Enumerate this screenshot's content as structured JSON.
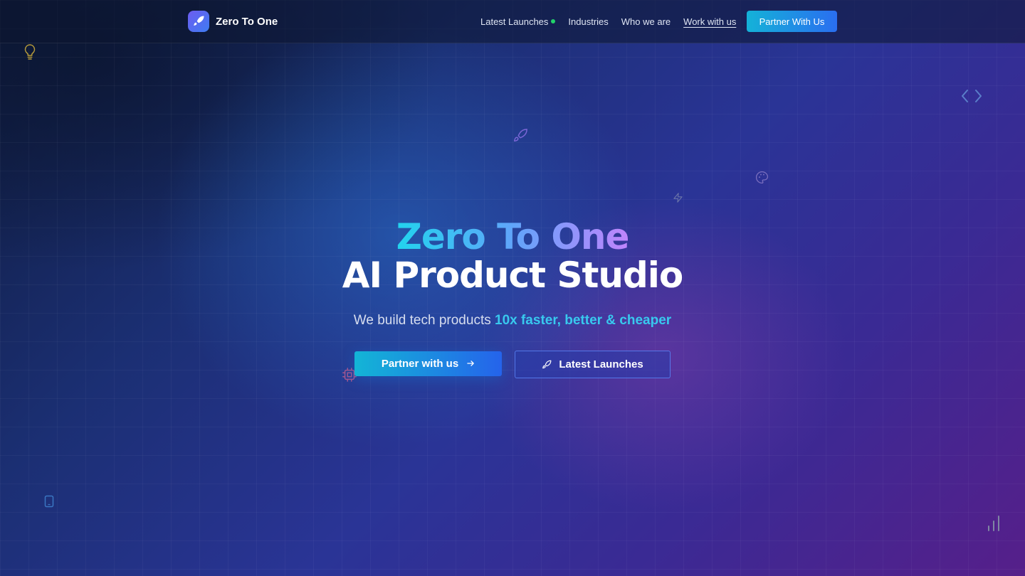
{
  "brand": {
    "name": "Zero To One",
    "logo_icon": "rocket-icon"
  },
  "nav": {
    "links": [
      {
        "label": "Latest Launches",
        "live_indicator_color": "#22d36a"
      },
      {
        "label": "Industries"
      },
      {
        "label": "Who we are"
      },
      {
        "label": "Work with us"
      }
    ],
    "cta_label": "Partner With Us"
  },
  "hero": {
    "title_line1": "Zero To One",
    "title_line2": "AI Product Studio",
    "tagline_prefix": "We build tech products ",
    "tagline_highlight": "10x faster, better & cheaper",
    "primary_button": {
      "label": "Partner with us",
      "icon": "arrow-right-icon"
    },
    "secondary_button": {
      "label": "Latest Launches",
      "icon": "rocket-icon"
    }
  },
  "decorative_icons": [
    "lightbulb-icon",
    "code-brackets-icon",
    "rocket-icon",
    "palette-icon",
    "lightning-icon",
    "cpu-chip-icon",
    "mobile-phone-icon",
    "bar-chart-icon"
  ],
  "colors": {
    "accent_cyan": "#22d3ee",
    "accent_blue": "#2563eb",
    "accent_purple": "#c084fc",
    "live_dot": "#22d36a"
  }
}
